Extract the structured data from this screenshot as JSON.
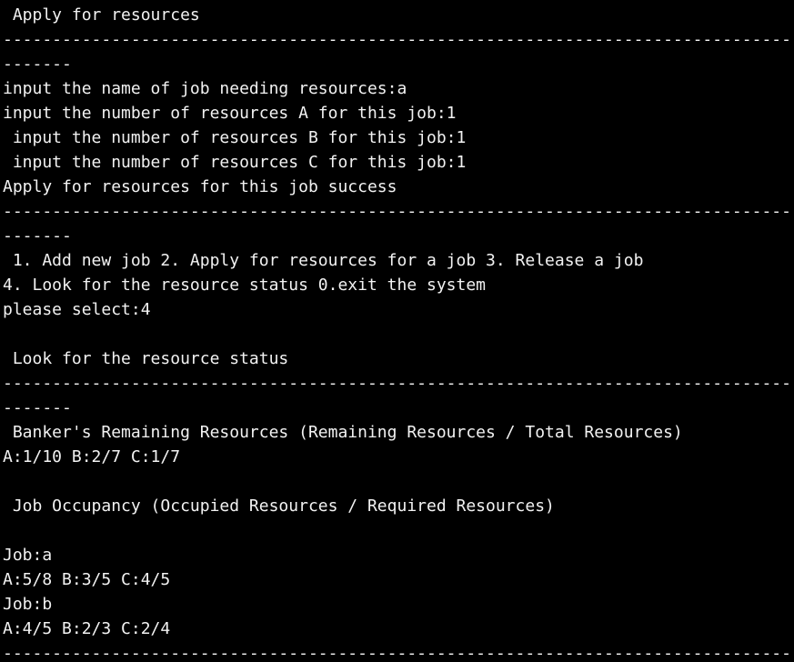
{
  "terminal": {
    "background": "#000000",
    "foreground": "#f2f2f2",
    "lines": [
      " Apply for resources",
      "-------------------------------------------------------------------------------------------------",
      "-------",
      "input the name of job needing resources:a",
      "input the number of resources A for this job:1",
      " input the number of resources B for this job:1",
      " input the number of resources C for this job:1",
      "Apply for resources for this job success",
      "-------------------------------------------------------------------------------------------------",
      "-------",
      " 1. Add new job 2. Apply for resources for a job 3. Release a job",
      "4. Look for the resource status 0.exit the system",
      "please select:4",
      "",
      " Look for the resource status",
      "-------------------------------------------------------------------------------------------------",
      "-------",
      " Banker's Remaining Resources (Remaining Resources / Total Resources)",
      "A:1/10 B:2/7 C:1/7",
      "",
      " Job Occupancy (Occupied Resources / Required Resources)",
      "",
      "Job:a",
      "A:5/8 B:3/5 C:4/5",
      "Job:b",
      "A:4/5 B:2/3 C:2/4",
      "-------------------------------------------------------------------------------------------------"
    ]
  }
}
